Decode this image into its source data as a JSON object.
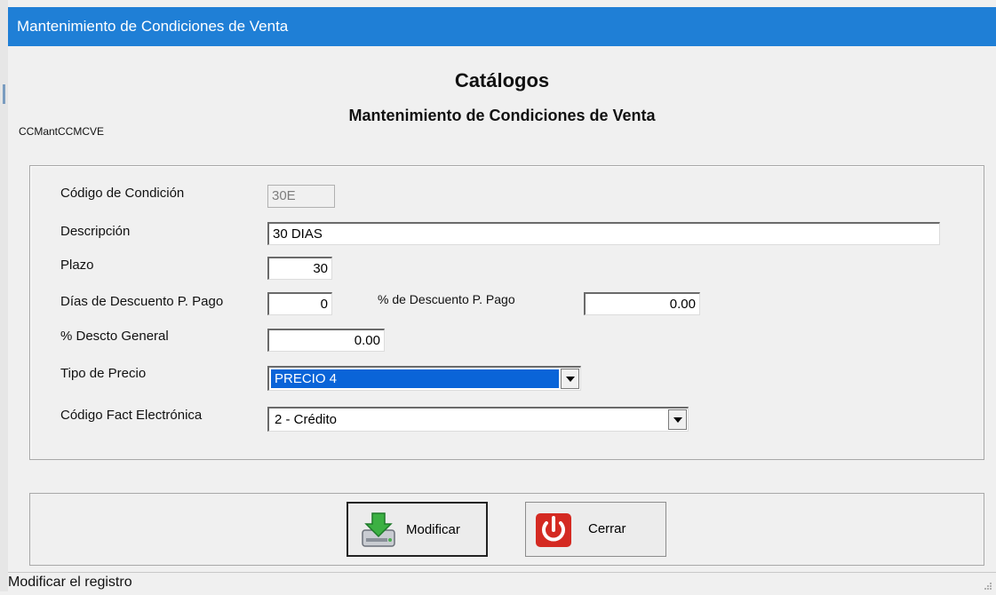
{
  "window": {
    "title": "Mantenimiento de Condiciones de Venta"
  },
  "header": {
    "title": "Catálogos",
    "subtitle": "Mantenimiento de Condiciones de Venta",
    "form_code": "CCMantCCMCVE"
  },
  "form": {
    "codigo_label": "Código de Condición",
    "codigo_value": "30E",
    "descripcion_label": "Descripción",
    "descripcion_value": "30 DIAS",
    "plazo_label": "Plazo",
    "plazo_value": "30",
    "dias_descuento_label": "Días de Descuento P. Pago",
    "dias_descuento_value": "0",
    "pct_descuento_pp_label": "% de Descuento P. Pago",
    "pct_descuento_pp_value": "0.00",
    "pct_descto_general_label": "% Descto General",
    "pct_descto_general_value": "0.00",
    "tipo_precio_label": "Tipo de Precio",
    "tipo_precio_value": "PRECIO 4",
    "codigo_fact_label": "Código Fact Electrónica",
    "codigo_fact_value": "2 - Crédito"
  },
  "buttons": {
    "modificar_label": "Modificar",
    "cerrar_label": "Cerrar"
  },
  "status": {
    "text": "Modificar el registro"
  },
  "icons": {
    "modificar": "save-drive-green-arrow-icon",
    "cerrar": "power-off-icon"
  },
  "colors": {
    "titlebar": "#1f7fd6",
    "selection": "#0a64d8",
    "power_red": "#d42a22"
  }
}
